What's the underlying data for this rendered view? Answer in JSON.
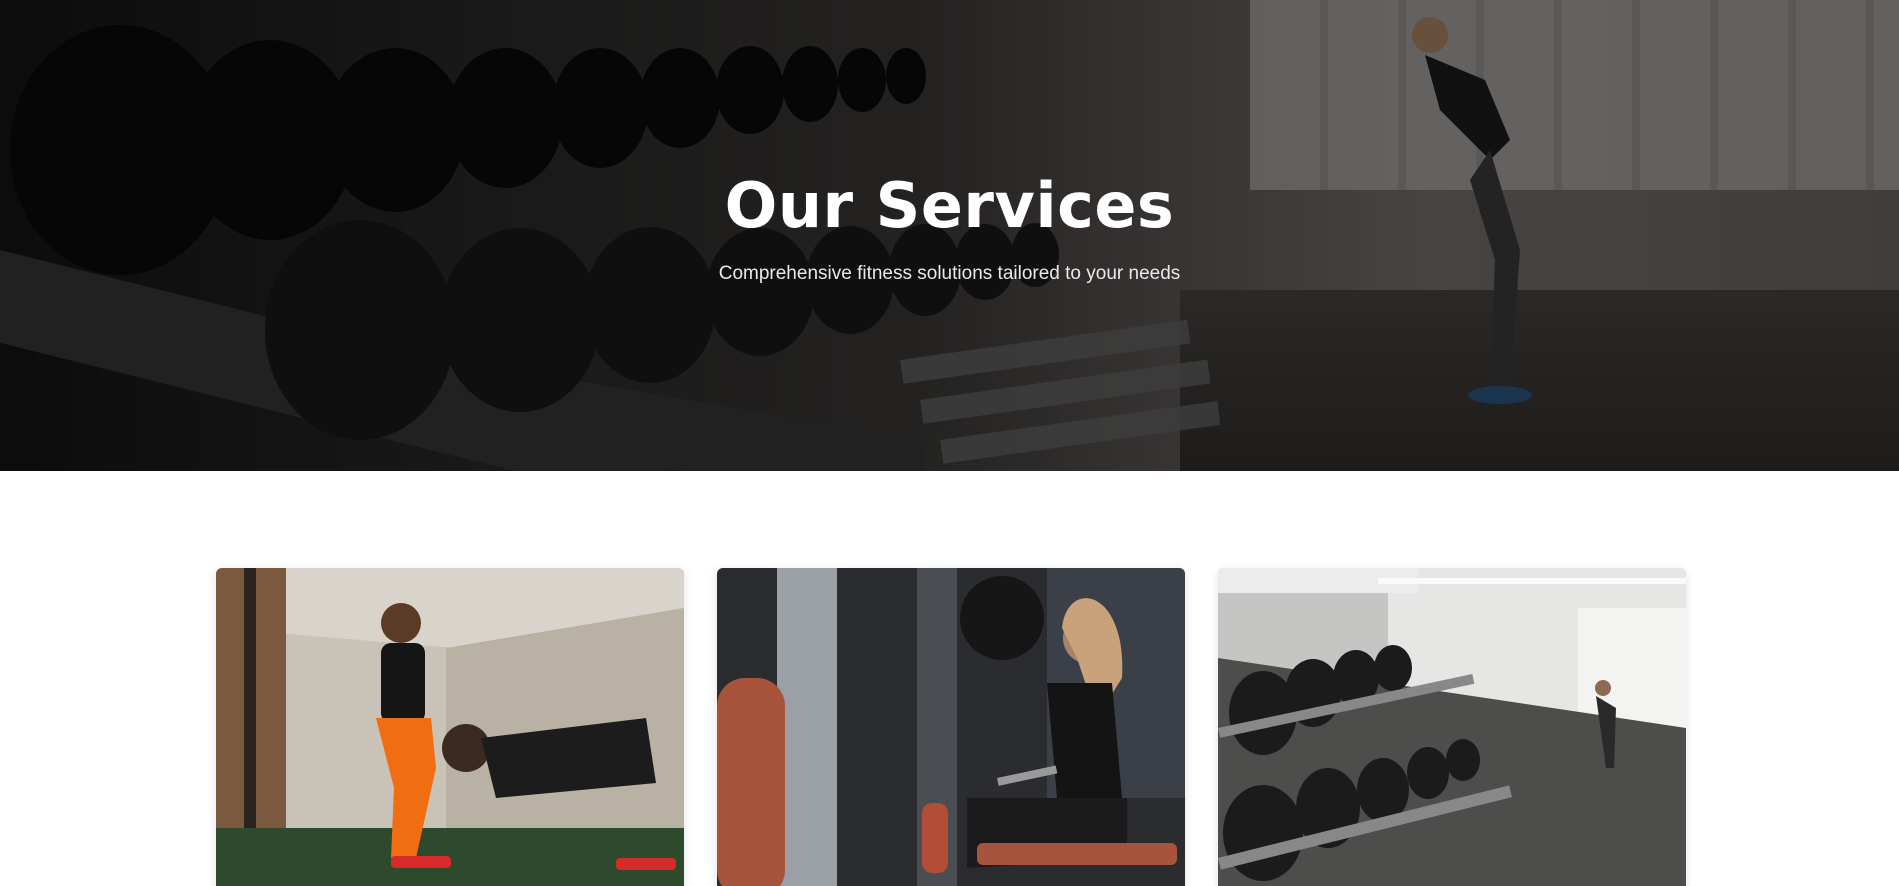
{
  "hero": {
    "title": "Our Services",
    "subtitle": "Comprehensive fitness solutions tailored to your needs",
    "image": "gym-dumbbell-rack-photo"
  },
  "services": {
    "cards": [
      {
        "image": "personal-trainer-pushup-photo"
      },
      {
        "image": "woman-cable-row-photo"
      },
      {
        "image": "dumbbell-rack-gym-photo"
      }
    ]
  },
  "colors": {
    "hero_overlay": "#000000",
    "hero_text": "#ffffff",
    "page_background": "#ffffff"
  }
}
